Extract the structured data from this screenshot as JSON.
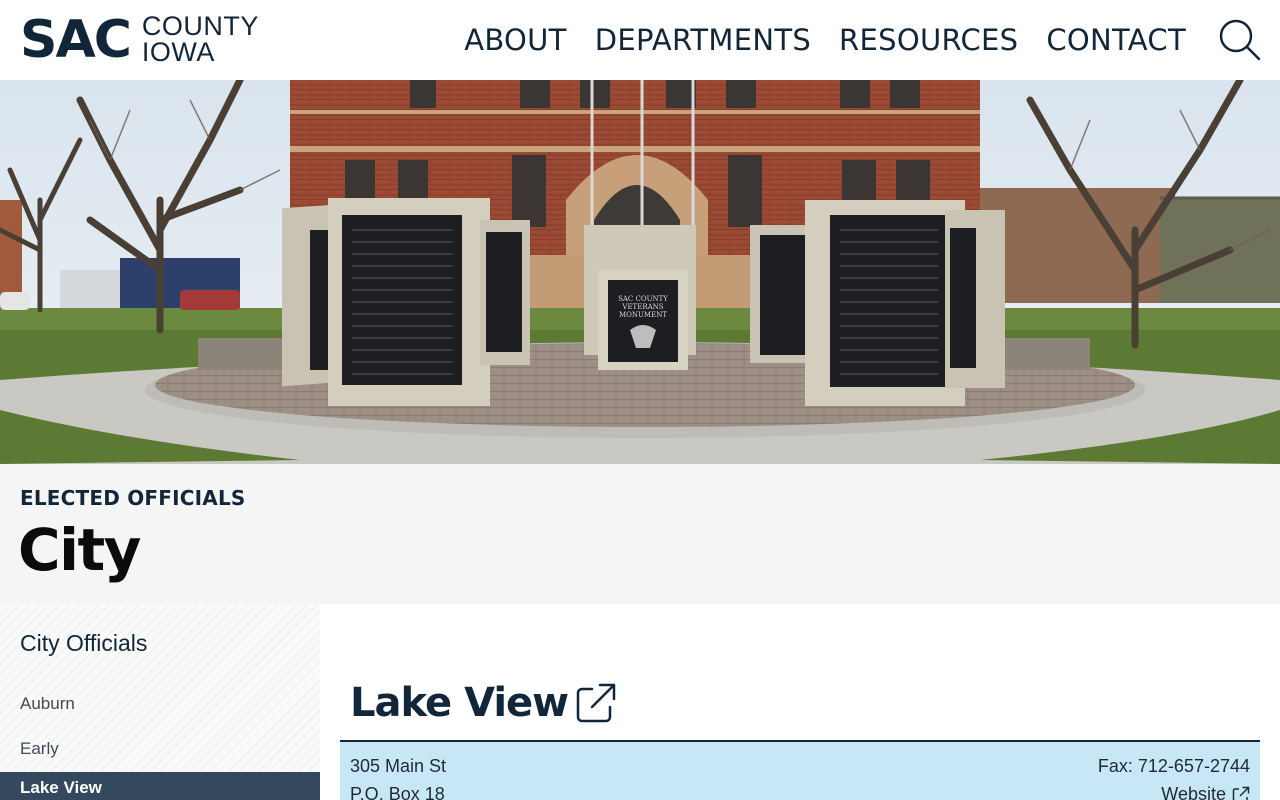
{
  "header": {
    "logo": {
      "main": "SAC",
      "line1": "COUNTY",
      "line2": "IOWA"
    },
    "nav": [
      {
        "label": "ABOUT"
      },
      {
        "label": "DEPARTMENTS"
      },
      {
        "label": "RESOURCES"
      },
      {
        "label": "CONTACT"
      }
    ],
    "search_icon": "search-icon"
  },
  "hero": {
    "monument_text": [
      "SAC COUNTY",
      "VETERANS",
      "MONUMENT"
    ]
  },
  "title_band": {
    "eyebrow": "ELECTED OFFICIALS",
    "title": "City"
  },
  "sidebar": {
    "heading": "City Officials",
    "items": [
      {
        "label": "Auburn",
        "active": false
      },
      {
        "label": "Early",
        "active": false
      },
      {
        "label": "Lake View",
        "active": true
      }
    ]
  },
  "main": {
    "city": "Lake View",
    "external_icon": "external-link-icon",
    "address_line1": "305 Main St",
    "address_line2": "P.O. Box 18",
    "fax": "Fax: 712-657-2744",
    "website": "Website"
  },
  "colors": {
    "navy": "#12263a",
    "sidebar_active": "#34495e",
    "info_box": "#c7e7f6",
    "band": "#f5f5f5"
  }
}
